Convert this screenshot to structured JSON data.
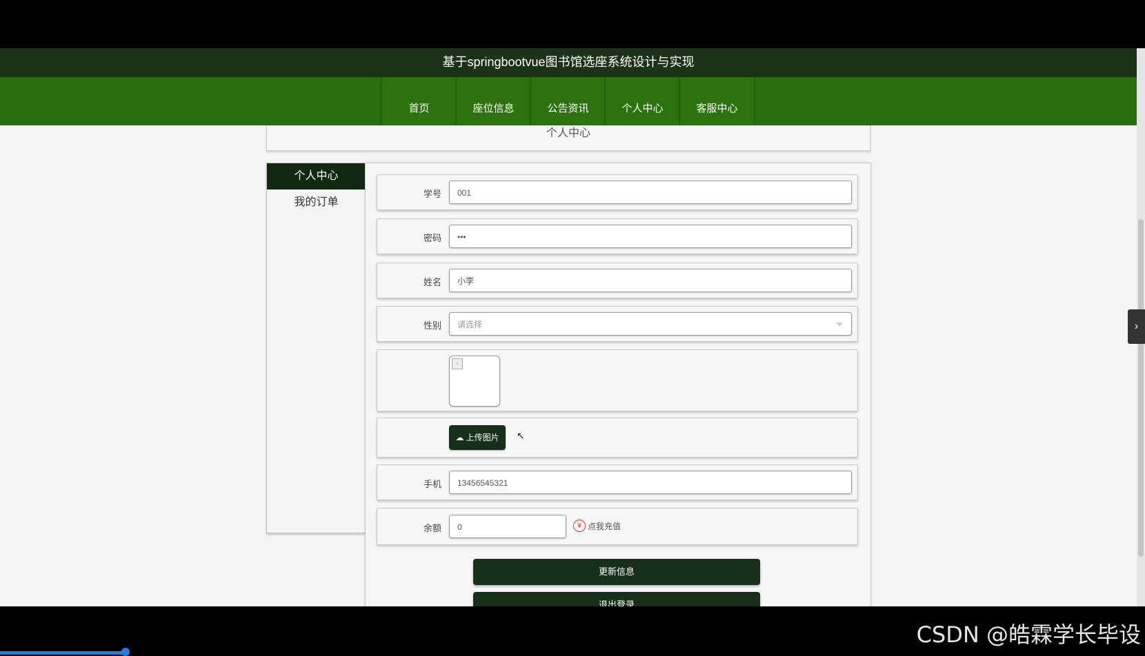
{
  "header": {
    "title": "基于springbootvue图书馆选座系统设计与实现"
  },
  "nav": {
    "items": [
      "首页",
      "座位信息",
      "公告资讯",
      "个人中心",
      "客服中心"
    ]
  },
  "page": {
    "title": "个人中心"
  },
  "sidebar": {
    "items": [
      {
        "label": "个人中心",
        "active": true
      },
      {
        "label": "我的订单",
        "active": false
      }
    ]
  },
  "form": {
    "student_id": {
      "label": "学号",
      "value": "001"
    },
    "password": {
      "label": "密码",
      "value": "•••"
    },
    "name": {
      "label": "姓名",
      "value": "小李"
    },
    "gender": {
      "label": "性别",
      "placeholder": "请选择"
    },
    "upload_label": "上传图片",
    "phone": {
      "label": "手机",
      "value": "13456545321"
    },
    "balance": {
      "label": "余额",
      "value": "0"
    },
    "recharge_label": "点我充值",
    "update_button": "更新信息",
    "logout_button": "退出登录"
  },
  "watermark": "CSDN @皓霖学长毕设",
  "colors": {
    "topbar": "#1d3317",
    "nav": "#2a6e10",
    "button": "#16301a"
  }
}
